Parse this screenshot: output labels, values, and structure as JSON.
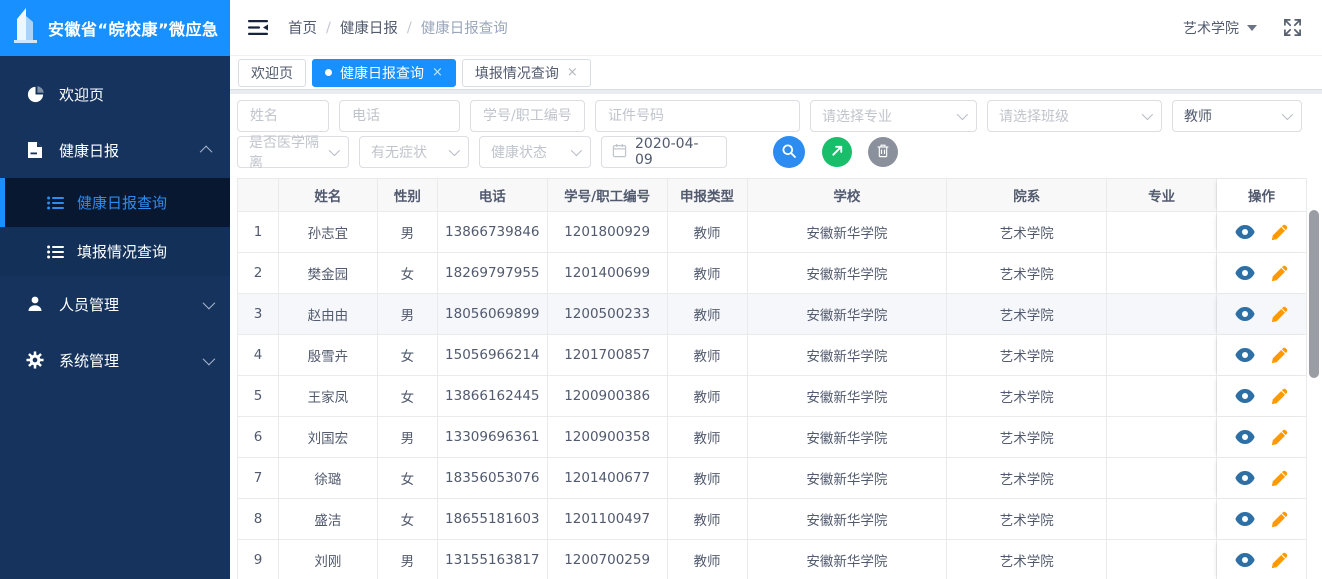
{
  "app": {
    "logo_title": "安徽省“皖校康”微应急"
  },
  "sidebar": {
    "items": [
      {
        "label": "欢迎页",
        "icon": "dashboard-icon"
      },
      {
        "label": "健康日报",
        "icon": "document-icon",
        "expanded": true,
        "children": [
          {
            "label": "健康日报查询",
            "active": true
          },
          {
            "label": "填报情况查询",
            "active": false
          }
        ]
      },
      {
        "label": "人员管理",
        "icon": "user-icon",
        "expanded": false
      },
      {
        "label": "系统管理",
        "icon": "gear-icon",
        "expanded": false
      }
    ]
  },
  "topbar": {
    "breadcrumb": [
      "首页",
      "健康日报",
      "健康日报查询"
    ],
    "breadcrumb_separator": "/",
    "org_selector": "艺术学院"
  },
  "tabs": [
    {
      "label": "欢迎页",
      "active": false,
      "closable": false
    },
    {
      "label": "健康日报查询",
      "active": true,
      "closable": true
    },
    {
      "label": "填报情况查询",
      "active": false,
      "closable": true
    }
  ],
  "filters": {
    "name_placeholder": "姓名",
    "phone_placeholder": "电话",
    "staff_id_placeholder": "学号/职工编号",
    "id_card_placeholder": "证件号码",
    "major_placeholder": "请选择专业",
    "class_placeholder": "请选择班级",
    "person_type_value": "教师",
    "isolation_placeholder": "是否医学隔离",
    "symptom_placeholder": "有无症状",
    "health_placeholder": "健康状态",
    "date_value": "2020-04-09"
  },
  "icons": {
    "close_glyph": "×"
  },
  "table": {
    "columns": [
      "",
      "姓名",
      "性别",
      "电话",
      "学号/职工编号",
      "申报类型",
      "学校",
      "院系",
      "专业",
      "操作"
    ],
    "rows": [
      {
        "index": 1,
        "name": "孙志宜",
        "gender": "男",
        "phone": "13866739846",
        "staff_id": "1201800929",
        "type": "教师",
        "school": "安徽新华学院",
        "department": "艺术学院",
        "major": ""
      },
      {
        "index": 2,
        "name": "樊金园",
        "gender": "女",
        "phone": "18269797955",
        "staff_id": "1201400699",
        "type": "教师",
        "school": "安徽新华学院",
        "department": "艺术学院",
        "major": ""
      },
      {
        "index": 3,
        "name": "赵由由",
        "gender": "男",
        "phone": "18056069899",
        "staff_id": "1200500233",
        "type": "教师",
        "school": "安徽新华学院",
        "department": "艺术学院",
        "major": "",
        "highlighted": true
      },
      {
        "index": 4,
        "name": "殷雪卉",
        "gender": "女",
        "phone": "15056966214",
        "staff_id": "1201700857",
        "type": "教师",
        "school": "安徽新华学院",
        "department": "艺术学院",
        "major": ""
      },
      {
        "index": 5,
        "name": "王家凤",
        "gender": "女",
        "phone": "13866162445",
        "staff_id": "1200900386",
        "type": "教师",
        "school": "安徽新华学院",
        "department": "艺术学院",
        "major": ""
      },
      {
        "index": 6,
        "name": "刘国宏",
        "gender": "男",
        "phone": "13309696361",
        "staff_id": "1200900358",
        "type": "教师",
        "school": "安徽新华学院",
        "department": "艺术学院",
        "major": ""
      },
      {
        "index": 7,
        "name": "徐璐",
        "gender": "女",
        "phone": "18356053076",
        "staff_id": "1201400677",
        "type": "教师",
        "school": "安徽新华学院",
        "department": "艺术学院",
        "major": ""
      },
      {
        "index": 8,
        "name": "盛洁",
        "gender": "女",
        "phone": "18655181603",
        "staff_id": "1201100497",
        "type": "教师",
        "school": "安徽新华学院",
        "department": "艺术学院",
        "major": ""
      },
      {
        "index": 9,
        "name": "刘刚",
        "gender": "男",
        "phone": "13155163817",
        "staff_id": "1200700259",
        "type": "教师",
        "school": "安徽新华学院",
        "department": "艺术学院",
        "major": ""
      }
    ]
  },
  "colors": {
    "accent_blue": "#1890ff",
    "search_button_blue": "#2d8cf0",
    "export_button_green": "#19be6b",
    "delete_button_gray": "#8a919c",
    "view_icon_blue": "#2e6fa5",
    "edit_icon_orange": "#ff9900",
    "sidebar_navy": "#16335e",
    "sidebar_active_bg": "#081830",
    "row_highlight": "#f5f7fa"
  }
}
